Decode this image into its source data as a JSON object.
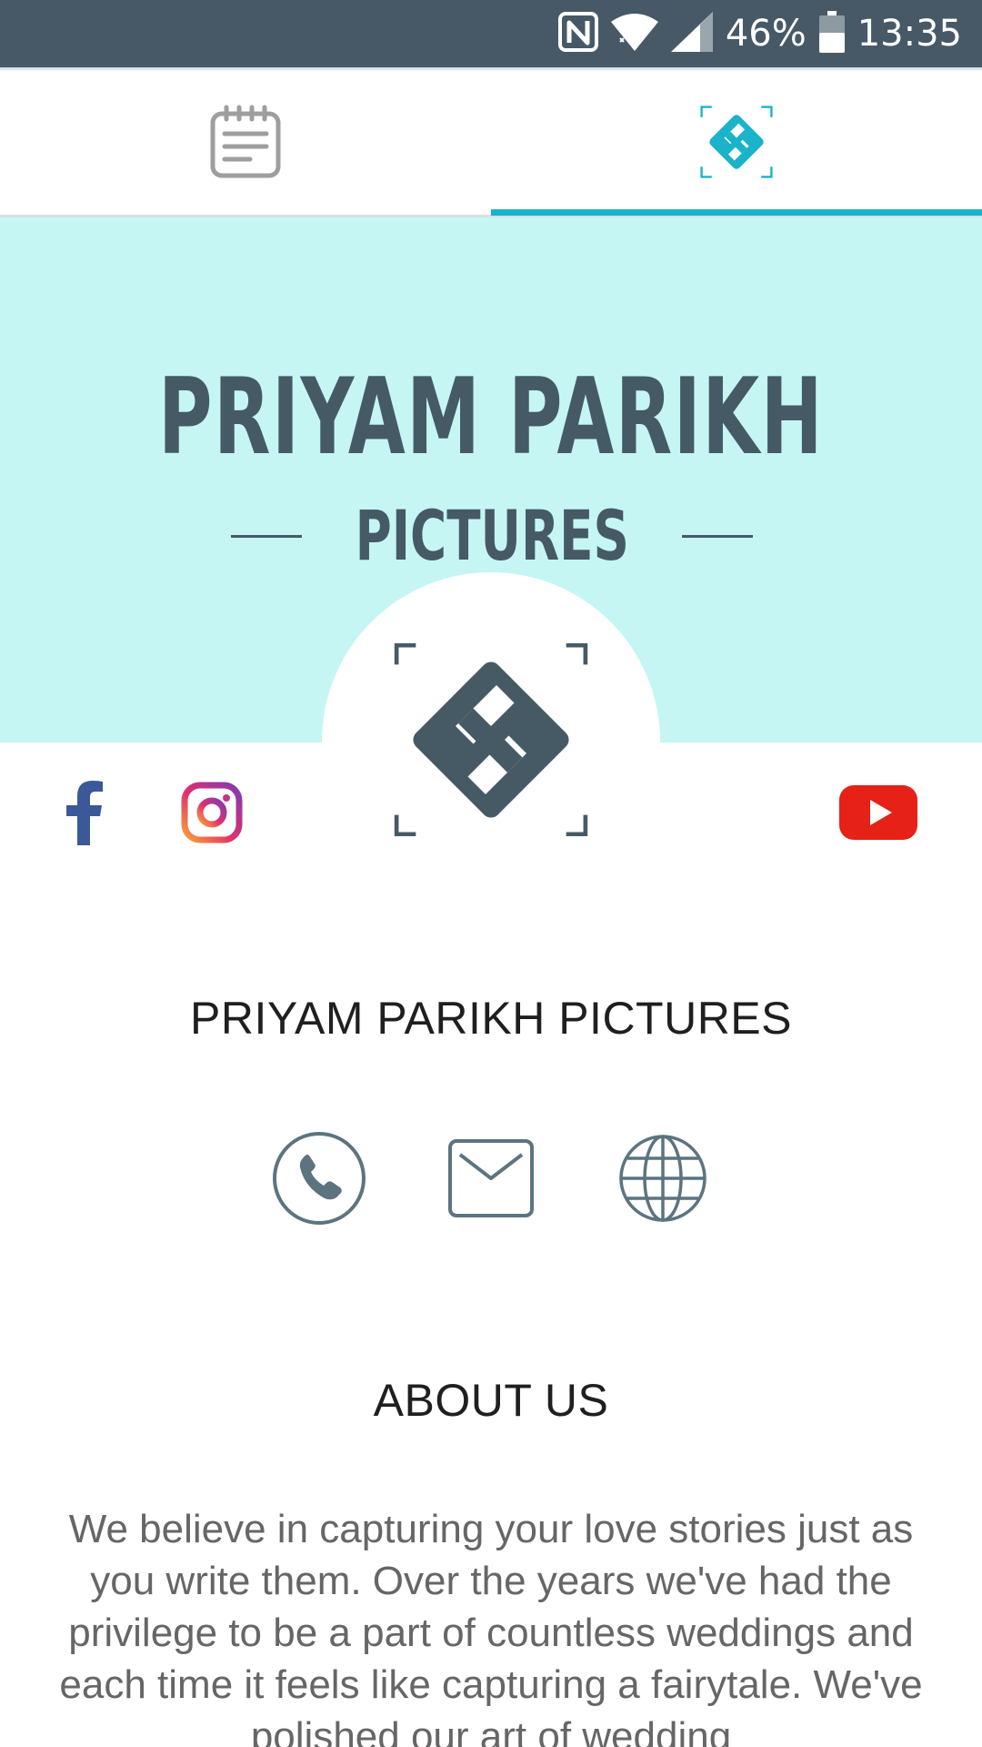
{
  "status_bar": {
    "battery": "46%",
    "time": "13:35"
  },
  "tabs": [
    {
      "name": "details",
      "active": false
    },
    {
      "name": "profile",
      "active": true
    }
  ],
  "banner": {
    "title": "PRIYAM PARIKH",
    "subtitle": "PICTURES",
    "background": "#c5f6f4"
  },
  "colors": {
    "accent": "#1ab3c9",
    "brand_dark": "#465a66",
    "facebook": "#3b5998",
    "youtube": "#e62117"
  },
  "social": [
    "facebook-icon",
    "instagram-icon",
    "youtube-icon"
  ],
  "profile": {
    "name": "PRIYAM PARIKH PICTURES"
  },
  "contacts": [
    "phone-icon",
    "mail-icon",
    "globe-icon"
  ],
  "about": {
    "title": "ABOUT US",
    "text": "We believe in capturing your love stories just as you write them. Over the years we've had the privilege to be a part of countless weddings and each time it feels like capturing a fairytale. We've polished our art of wedding"
  }
}
